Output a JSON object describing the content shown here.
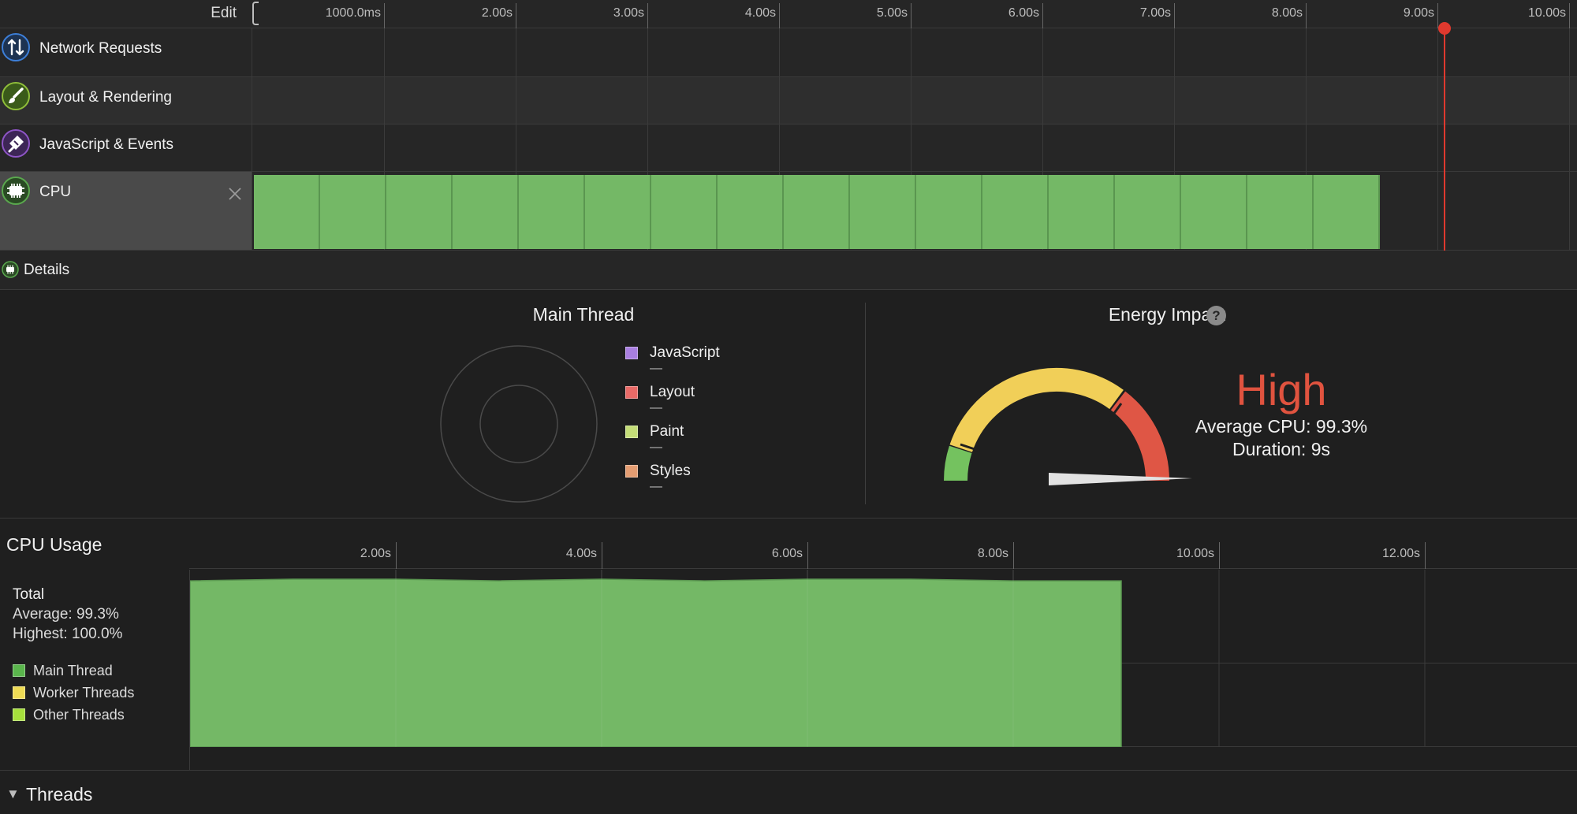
{
  "timeline": {
    "edit_label": "Edit",
    "ruler_labels": [
      "1000.0ms",
      "2.00s",
      "3.00s",
      "4.00s",
      "5.00s",
      "6.00s",
      "7.00s",
      "8.00s",
      "9.00s",
      "10.00s"
    ],
    "playhead_color": "#e0392e"
  },
  "tracks": [
    {
      "label": "Network Requests",
      "icon": "network-arrows-icon",
      "color": "#3d7fd8"
    },
    {
      "label": "Layout & Rendering",
      "icon": "paintbrush-icon",
      "color": "#8fbe3a"
    },
    {
      "label": "JavaScript & Events",
      "icon": "javascript-events-icon",
      "color": "#8e55c6"
    },
    {
      "label": "CPU",
      "icon": "cpu-chip-icon",
      "color": "#5aa84e",
      "selected": true,
      "segment_count": 17,
      "segment_color": "#74b866"
    }
  ],
  "details": {
    "label": "Details",
    "icon": "cpu-chip-icon"
  },
  "main_thread": {
    "title": "Main Thread",
    "legend": [
      {
        "label": "JavaScript",
        "value": "—",
        "color": "#a97fe0"
      },
      {
        "label": "Layout",
        "value": "—",
        "color": "#e86a67"
      },
      {
        "label": "Paint",
        "value": "—",
        "color": "#c4dd78"
      },
      {
        "label": "Styles",
        "value": "—",
        "color": "#e49d72"
      }
    ]
  },
  "energy": {
    "title": "Energy Impact",
    "help_label": "?",
    "level": "High",
    "level_color": "#e0533f",
    "average_cpu": "Average CPU: 99.3%",
    "duration": "Duration: 9s",
    "gauge_colors": {
      "low": "#74c25f",
      "medium": "#f1cf58",
      "high": "#df5645"
    }
  },
  "cpu_usage": {
    "title": "CPU Usage",
    "ruler_labels": [
      "2.00s",
      "4.00s",
      "6.00s",
      "8.00s",
      "10.00s",
      "12.00s"
    ],
    "total_label": "Total",
    "average": "Average: 99.3%",
    "highest": "Highest: 100.0%",
    "legend": [
      {
        "label": "Main Thread",
        "color": "#5ab54c"
      },
      {
        "label": "Worker Threads",
        "color": "#eedb55"
      },
      {
        "label": "Other Threads",
        "color": "#a6df3c"
      }
    ]
  },
  "chart_data": {
    "type": "area",
    "title": "CPU Usage",
    "xlabel": "",
    "ylabel": "",
    "x_unit": "s",
    "xlim": [
      0,
      13.4
    ],
    "ylim": [
      0,
      100
    ],
    "x_ticks": [
      "2.00s",
      "4.00s",
      "6.00s",
      "8.00s",
      "10.00s",
      "12.00s"
    ],
    "grid": true,
    "series": [
      {
        "name": "Main Thread",
        "color": "#74b866",
        "x": [
          0,
          1,
          2,
          3,
          4,
          5,
          6,
          7,
          8,
          9.05
        ],
        "values": [
          99,
          100,
          100,
          99,
          100,
          99,
          100,
          100,
          99,
          99
        ]
      }
    ]
  },
  "threads": {
    "label": "Threads",
    "disclosure": "▼"
  }
}
